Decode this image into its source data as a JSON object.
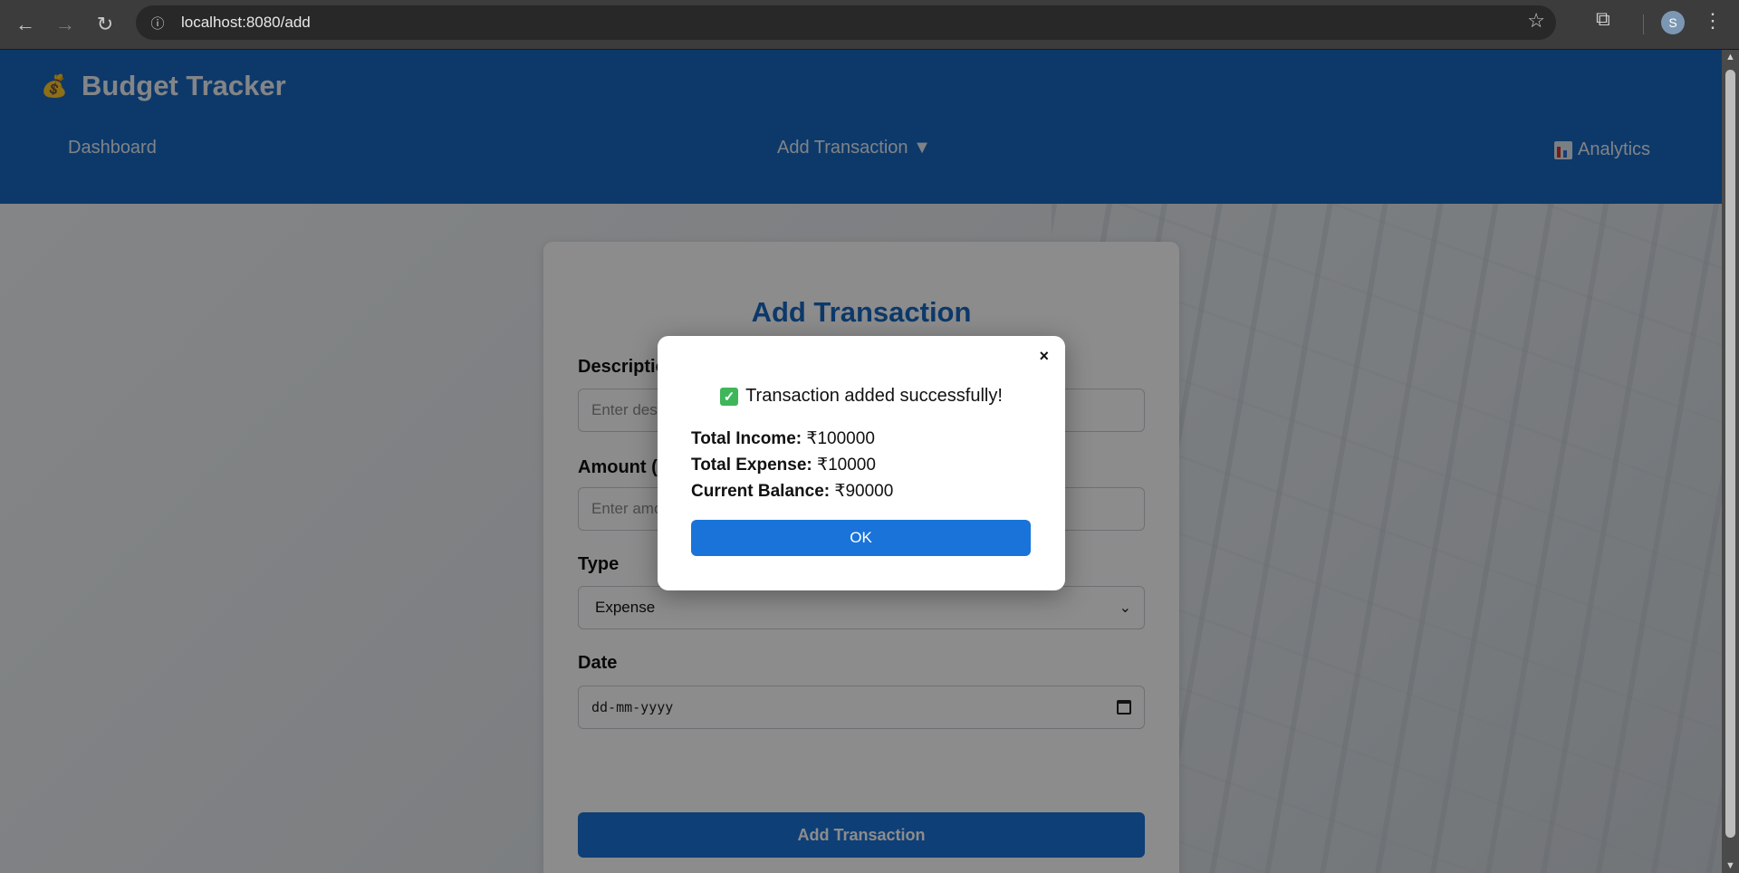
{
  "browser": {
    "url": "localhost:8080/add",
    "profile_initial": "S",
    "icons": {
      "back": "back-arrow-icon",
      "forward": "forward-arrow-icon",
      "reload": "reload-icon",
      "site_info": "info-icon",
      "bookmark": "star-icon",
      "extensions": "puzzle-icon",
      "menu": "kebab-menu-icon"
    }
  },
  "app": {
    "title": "Budget Tracker",
    "logo_icon": "budget-logo-icon",
    "accent": "#1868c2"
  },
  "nav": {
    "dashboard": "Dashboard",
    "add_transaction": "Add Transaction ▼",
    "analytics": "Analytics"
  },
  "form": {
    "title": "Add Transaction",
    "description_label": "Description",
    "description_placeholder": "Enter description",
    "amount_label": "Amount (₹)",
    "amount_placeholder": "Enter amount",
    "type_label": "Type",
    "type_value": "Expense",
    "date_label": "Date",
    "date_placeholder": "dd-mm-yyyy",
    "submit_label": "Add Transaction"
  },
  "modal": {
    "message": "Transaction added successfully!",
    "income_label": "Total Income:",
    "income_value": "₹100000",
    "expense_label": "Total Expense:",
    "expense_value": "₹10000",
    "balance_label": "Current Balance:",
    "balance_value": "₹90000",
    "ok_label": "OK",
    "close_glyph": "×"
  }
}
